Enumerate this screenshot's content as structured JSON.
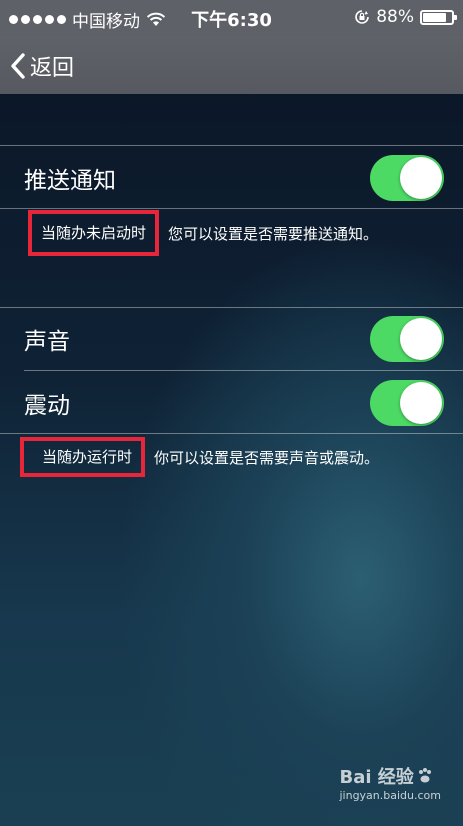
{
  "status_bar": {
    "carrier": "中国移动",
    "time": "下午6:30",
    "battery": "88%",
    "battery_level": 0.88
  },
  "nav": {
    "back_label": "返回"
  },
  "settings": {
    "push": {
      "label": "推送通知",
      "on": true
    },
    "push_note": {
      "highlight": "当随办未启动时",
      "text": "您可以设置是否需要推送通知。"
    },
    "sound": {
      "label": "声音",
      "on": true
    },
    "vibrate": {
      "label": "震动",
      "on": true
    },
    "run_note": {
      "highlight": "当随办运行时",
      "text": "你可以设置是否需要声音或震动。"
    }
  },
  "watermark": {
    "brand": "Bai 经验",
    "url": "jingyan.baidu.com"
  },
  "colors": {
    "toggle_on": "#4cd964",
    "highlight_border": "#e8263a",
    "nav_bar": "#5e6167"
  }
}
